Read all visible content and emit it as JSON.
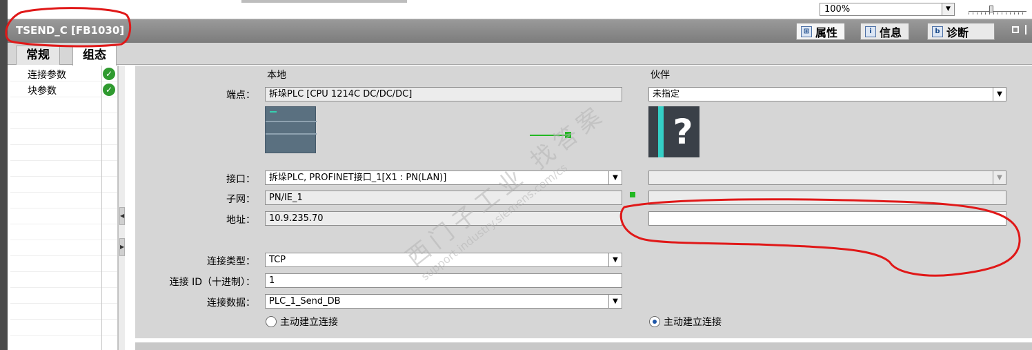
{
  "toolbar": {
    "zoom": "100%"
  },
  "title_bar": {
    "title": "TSEND_C [FB1030]",
    "tabs": [
      {
        "label": "属性",
        "icon": "properties-icon",
        "active": true
      },
      {
        "label": "信息",
        "icon": "info-icon",
        "active": false
      },
      {
        "label": "诊断",
        "icon": "diagnostics-icon",
        "active": false
      }
    ]
  },
  "tabs": [
    {
      "label": "常规",
      "active": false
    },
    {
      "label": "组态",
      "active": true
    }
  ],
  "nav": {
    "items": [
      {
        "label": "连接参数",
        "status": "ok"
      },
      {
        "label": "块参数",
        "status": "ok"
      }
    ]
  },
  "form": {
    "local_header": "本地",
    "partner_header": "伙伴",
    "endpoint_label": "端点：",
    "endpoint_local": "拆垛PLC [CPU 1214C DC/DC/DC]",
    "endpoint_partner": "未指定",
    "interface_label": "接口：",
    "interface_local": "拆垛PLC, PROFINET接口_1[X1 : PN(LAN)]",
    "interface_partner": "",
    "subnet_label": "子网：",
    "subnet_local": "PN/IE_1",
    "subnet_partner": "",
    "address_label": "地址：",
    "address_local": "10.9.235.70",
    "address_partner": "",
    "conn_type_label": "连接类型：",
    "conn_type": "TCP",
    "conn_id_label": "连接 ID（十进制）：",
    "conn_id": "1",
    "conn_data_label": "连接数据：",
    "conn_data": "PLC_1_Send_DB",
    "local_active_label": "主动建立连接",
    "partner_active_label": "主动建立连接"
  },
  "watermark": {
    "line1": "西门子工业  找答案",
    "line2": "support.industry.siemens.com/cs"
  },
  "colors": {
    "title_bar": "#8a8a8a",
    "panel": "#d6d6d6",
    "ok_green": "#2f9a2f",
    "annotation_red": "#e01818"
  }
}
